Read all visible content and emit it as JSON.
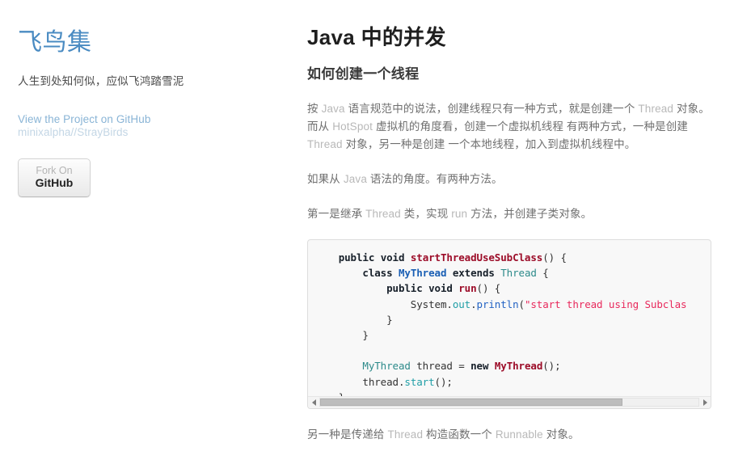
{
  "sidebar": {
    "site_title": "飞鸟集",
    "tagline": "人生到处知何似，应似飞鸿踏雪泥",
    "project_link": "View the Project on GitHub",
    "project_repo": "minixalpha//StrayBirds",
    "fork_button_line1": "Fork On",
    "fork_button_line2": "GitHub",
    "link_color": "#89b4d6",
    "title_color": "#4a8bc2"
  },
  "main": {
    "title": "Java 中的并发",
    "subtitle": "如何创建一个线程",
    "paragraph1_a": "按 ",
    "paragraph1_en1": "Java",
    "paragraph1_b": " 语言规范中的说法，创建线程只有一种方式，就是创建一个 ",
    "paragraph1_en2": "Thread",
    "paragraph1_c": " 对象。而从 ",
    "paragraph1_en3": "HotSpot",
    "paragraph1_d": " 虚拟机的角度看，创建一个虚拟机线程 有两种方式，一种是创建 ",
    "paragraph1_en4": "Thread",
    "paragraph1_e": " 对象，另一种是创建 一个本地线程，加入到虚拟机线程中。",
    "paragraph2_a": "如果从 ",
    "paragraph2_en1": "Java",
    "paragraph2_b": " 语法的角度。有两种方法。",
    "paragraph3_a": "第一是继承 ",
    "paragraph3_en1": "Thread",
    "paragraph3_b": " 类，实现 ",
    "paragraph3_en2": "run",
    "paragraph3_c": " 方法，并创建子类对象。",
    "paragraph4_a": "另一种是传递给 ",
    "paragraph4_en1": "Thread",
    "paragraph4_b": " 构造函数一个 ",
    "paragraph4_en2": "Runnable",
    "paragraph4_c": " 对象。"
  },
  "code_block": {
    "language": "java",
    "scroll_thumb_percent": 80,
    "lines": [
      "    public void startThreadUseSubClass() {",
      "        class MyThread extends Thread {",
      "            public void run() {",
      "                System.out.println(\"start thread using Subclas",
      "            }",
      "        }",
      "",
      "        MyThread thread = new MyThread();",
      "        thread.start();",
      "    }"
    ],
    "tokens": {
      "keyword_color": "#17202a",
      "function_color": "#9c0c28",
      "class_color": "#1a5fb4",
      "type_color": "#2c8a8a",
      "field_color": "#1f9ea6",
      "method_color": "#2363c4",
      "string_color": "#e8295c"
    }
  }
}
